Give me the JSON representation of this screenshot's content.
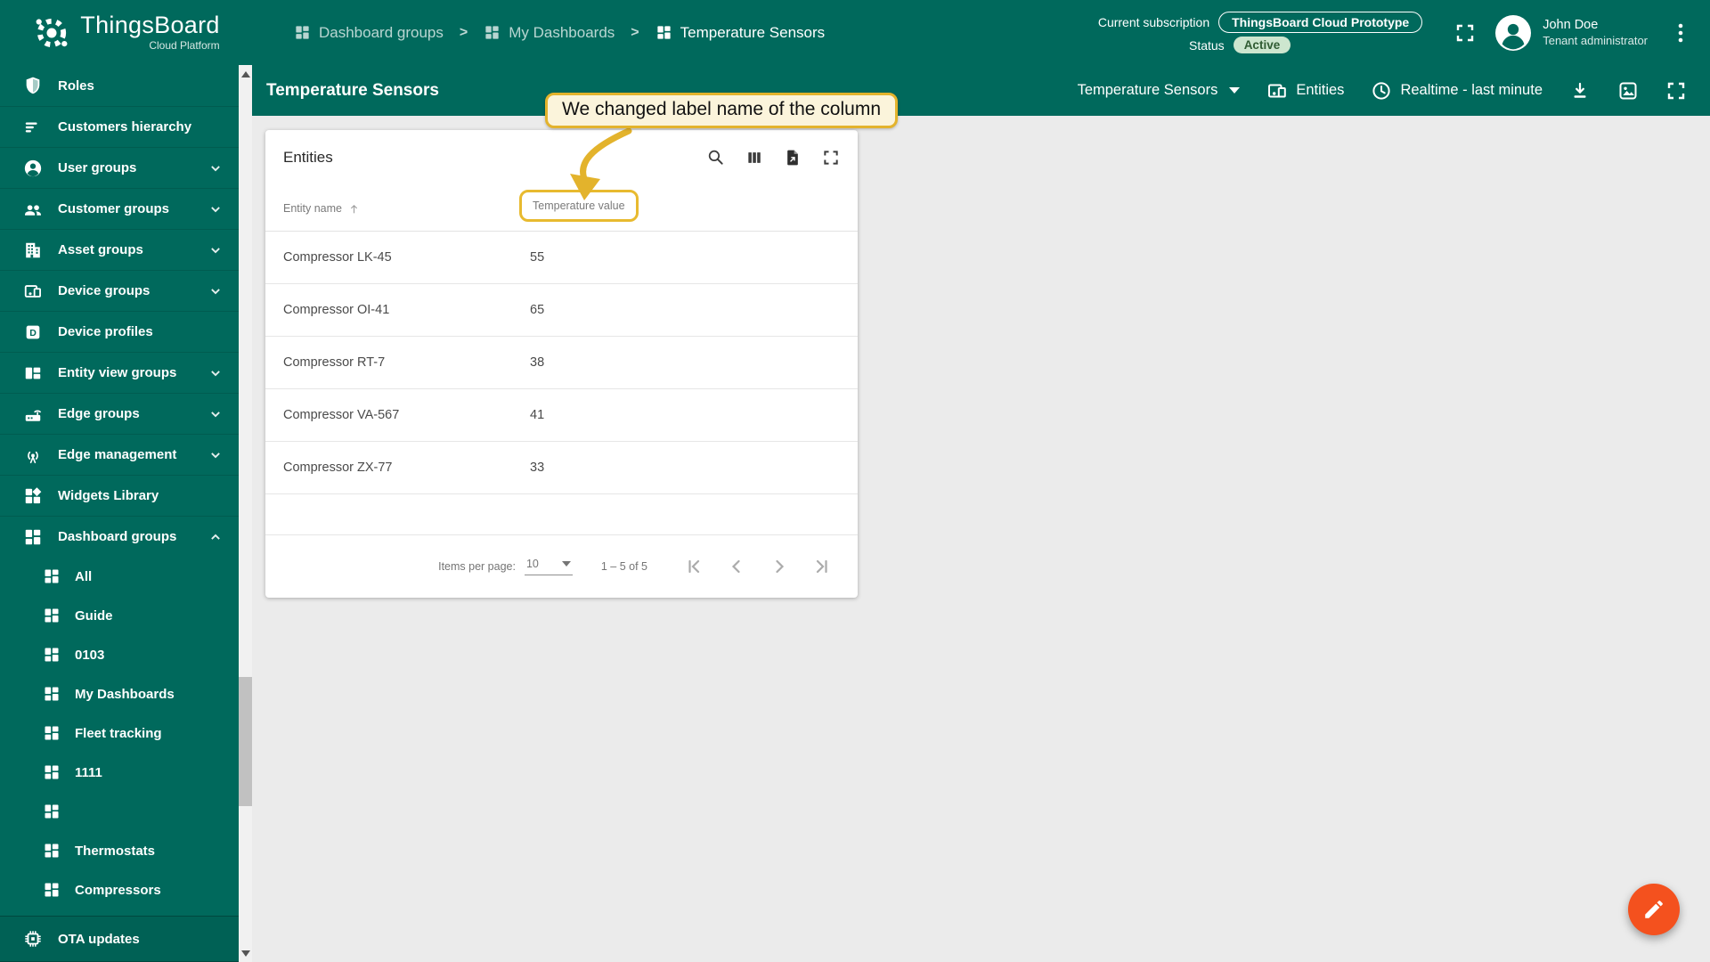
{
  "app": {
    "name": "ThingsBoard",
    "subtitle": "Cloud Platform"
  },
  "header": {
    "breadcrumb_separator": ">",
    "breadcrumbs": [
      {
        "label": "Dashboard groups"
      },
      {
        "label": "My Dashboards"
      },
      {
        "label": "Temperature Sensors"
      }
    ],
    "subscription": {
      "label": "Current subscription",
      "value": "ThingsBoard Cloud Prototype"
    },
    "status": {
      "label": "Status",
      "value": "Active"
    },
    "user": {
      "name": "John Doe",
      "role": "Tenant administrator"
    }
  },
  "sidebar": {
    "items": [
      {
        "label": "Roles"
      },
      {
        "label": "Customers hierarchy"
      },
      {
        "label": "User groups"
      },
      {
        "label": "Customer groups"
      },
      {
        "label": "Asset groups"
      },
      {
        "label": "Device groups"
      },
      {
        "label": "Device profiles"
      },
      {
        "label": "Entity view groups"
      },
      {
        "label": "Edge groups"
      },
      {
        "label": "Edge management"
      },
      {
        "label": "Widgets Library"
      },
      {
        "label": "Dashboard groups"
      }
    ],
    "dashboard_children": [
      {
        "label": "All"
      },
      {
        "label": "Guide"
      },
      {
        "label": "0103"
      },
      {
        "label": "My Dashboards"
      },
      {
        "label": "Fleet tracking"
      },
      {
        "label": "1111"
      },
      {
        "label": ""
      },
      {
        "label": "Thermostats"
      },
      {
        "label": "Compressors"
      }
    ],
    "footer": {
      "label": "OTA updates"
    }
  },
  "toolbar": {
    "title": "Temperature Sensors",
    "state_selector": "Temperature Sensors",
    "entities_button": "Entities",
    "timewindow": "Realtime - last minute"
  },
  "callout": {
    "text": "We changed label name of the column"
  },
  "widget": {
    "title": "Entities",
    "table": {
      "columns": [
        {
          "label": "Entity name"
        },
        {
          "label": "Temperature value"
        }
      ],
      "rows": [
        {
          "name": "Compressor LK-45",
          "value": "55"
        },
        {
          "name": "Compressor OI-41",
          "value": "65"
        },
        {
          "name": "Compressor RT-7",
          "value": "38"
        },
        {
          "name": "Compressor VA-567",
          "value": "41"
        },
        {
          "name": "Compressor ZX-77",
          "value": "33"
        }
      ]
    },
    "paginator": {
      "items_per_page_label": "Items per page:",
      "page_size": "10",
      "range": "1 – 5 of 5"
    }
  },
  "colors": {
    "primary": "#00695C",
    "accent_fab": "#F4511E",
    "callout_yellow": "#E3B32C",
    "status_badge_bg": "#CDE6CF",
    "status_badge_text": "#2F5B32",
    "content_bg": "#EBEBEB"
  }
}
